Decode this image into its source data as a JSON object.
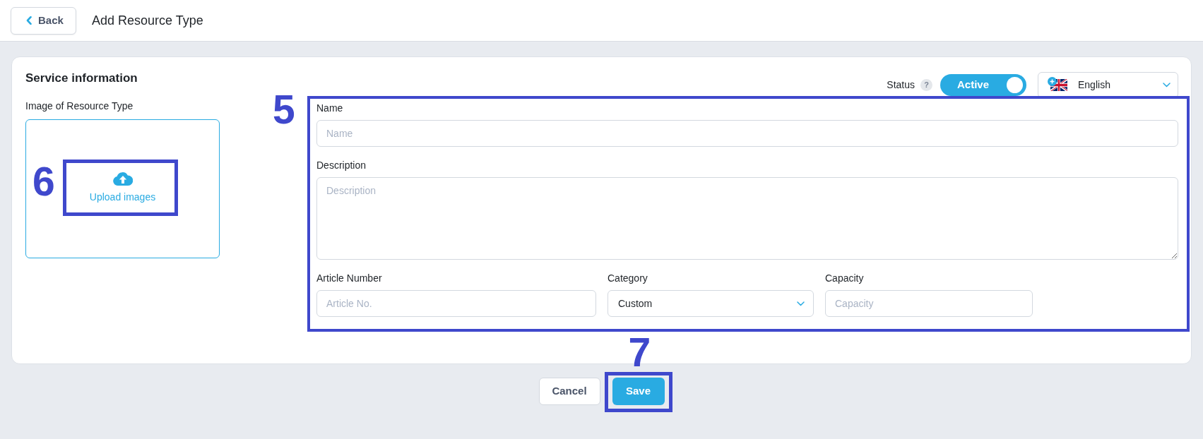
{
  "header": {
    "back_button": "Back",
    "title": "Add Resource Type"
  },
  "card": {
    "title": "Service information",
    "image": {
      "label": "Image of Resource Type",
      "upload": "Upload images",
      "annotation": "6"
    },
    "status": {
      "label": "Status",
      "help": "?",
      "toggle": {
        "label": "Active",
        "on": true
      }
    },
    "language": {
      "value": "English"
    },
    "form": {
      "annotation": "5",
      "rows": [
        {
          "fields": [
            {
              "kind": "text",
              "label": "Name",
              "placeholder": "Name"
            }
          ]
        },
        {
          "fields": [
            {
              "kind": "textarea",
              "label": "Description",
              "placeholder": "Description"
            }
          ]
        },
        {
          "fields": [
            {
              "kind": "text",
              "label": "Article Number",
              "placeholder": "Article No."
            },
            {
              "kind": "select",
              "label": "Category",
              "value": "Custom"
            },
            {
              "kind": "text",
              "label": "Capacity",
              "placeholder": "Capacity"
            }
          ]
        }
      ]
    }
  },
  "actions": [
    {
      "kind": "secondary",
      "label": "Cancel"
    },
    {
      "kind": "primary",
      "label": "Save",
      "annotation": "7"
    }
  ]
}
